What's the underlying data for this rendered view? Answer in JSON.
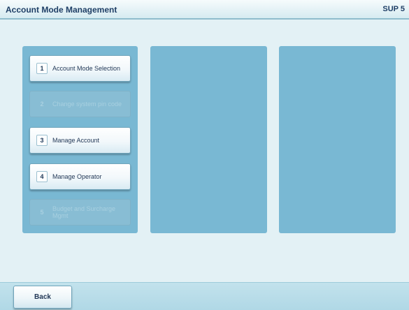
{
  "header": {
    "title": "Account Mode Management",
    "screen_code": "SUP 5"
  },
  "menu": {
    "items": [
      {
        "number": "1",
        "label": "Account Mode Selection",
        "enabled": true
      },
      {
        "number": "2",
        "label": "Change system pin code",
        "enabled": false
      },
      {
        "number": "3",
        "label": "Manage Account",
        "enabled": true
      },
      {
        "number": "4",
        "label": "Manage Operator",
        "enabled": true
      },
      {
        "number": "5",
        "label": "Budget and Surcharge Mgmt",
        "enabled": false
      }
    ]
  },
  "footer": {
    "back_label": "Back"
  },
  "colors": {
    "background": "#e3f1f5",
    "panel": "#79b8d3",
    "title_text": "#1f3f66"
  }
}
